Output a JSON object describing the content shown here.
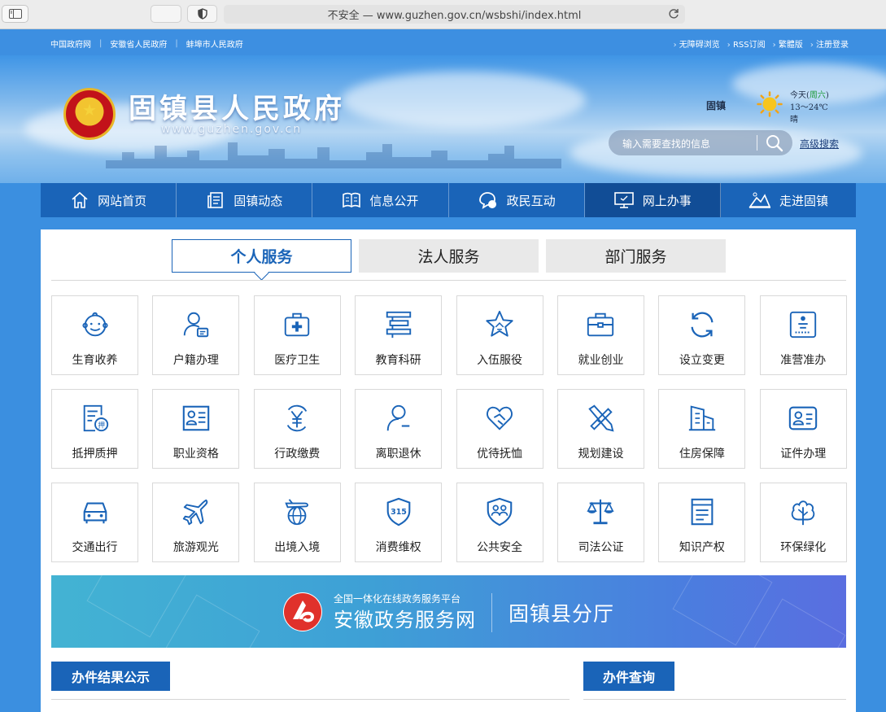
{
  "browser": {
    "url_text": "不安全 — www.guzhen.gov.cn/wsbshi/index.html"
  },
  "utilbar": {
    "left_links": [
      "中国政府网",
      "安徽省人民政府",
      "蚌埠市人民政府"
    ],
    "right_links": [
      "无障碍浏览",
      "RSS订阅",
      "繁體版",
      "注册登录"
    ]
  },
  "header": {
    "site_title": "固镇县人民政府",
    "site_url": "www.guzhen.gov.cn",
    "weather": {
      "city": "固镇",
      "day_prefix": "今天(",
      "weekday": "周六",
      "day_suffix": ")",
      "temp": "13～24℃",
      "condition": "晴"
    },
    "search_placeholder": "输入需要查找的信息",
    "advanced_search": "高级搜索"
  },
  "mainnav": [
    {
      "label": "网站首页",
      "icon": "home-icon",
      "active": false
    },
    {
      "label": "固镇动态",
      "icon": "news-icon",
      "active": false
    },
    {
      "label": "信息公开",
      "icon": "book-icon",
      "active": false
    },
    {
      "label": "政民互动",
      "icon": "chat-icon",
      "active": false
    },
    {
      "label": "网上办事",
      "icon": "monitor-icon",
      "active": true
    },
    {
      "label": "走进固镇",
      "icon": "landscape-icon",
      "active": false
    }
  ],
  "tabs": [
    {
      "label": "个人服务",
      "active": true
    },
    {
      "label": "法人服务",
      "active": false
    },
    {
      "label": "部门服务",
      "active": false
    }
  ],
  "services": [
    {
      "label": "生育收养",
      "icon": "baby-icon"
    },
    {
      "label": "户籍办理",
      "icon": "person-card-icon"
    },
    {
      "label": "医疗卫生",
      "icon": "medical-kit-icon"
    },
    {
      "label": "教育科研",
      "icon": "education-icon"
    },
    {
      "label": "入伍服役",
      "icon": "star-icon"
    },
    {
      "label": "就业创业",
      "icon": "briefcase-icon"
    },
    {
      "label": "设立变更",
      "icon": "refresh-icon"
    },
    {
      "label": "准营准办",
      "icon": "license-icon"
    },
    {
      "label": "抵押质押",
      "icon": "mortgage-icon"
    },
    {
      "label": "职业资格",
      "icon": "id-card-icon"
    },
    {
      "label": "行政缴费",
      "icon": "yen-icon"
    },
    {
      "label": "离职退休",
      "icon": "person-minus-icon"
    },
    {
      "label": "优待抚恤",
      "icon": "heart-hand-icon"
    },
    {
      "label": "规划建设",
      "icon": "ruler-pencil-icon"
    },
    {
      "label": "住房保障",
      "icon": "building-icon"
    },
    {
      "label": "证件办理",
      "icon": "id-document-icon"
    },
    {
      "label": "交通出行",
      "icon": "car-icon"
    },
    {
      "label": "旅游观光",
      "icon": "airplane-icon"
    },
    {
      "label": "出境入境",
      "icon": "plane-globe-icon"
    },
    {
      "label": "消费维权",
      "icon": "shield-315-icon"
    },
    {
      "label": "公共安全",
      "icon": "shield-people-icon"
    },
    {
      "label": "司法公证",
      "icon": "scales-icon"
    },
    {
      "label": "知识产权",
      "icon": "document-icon"
    },
    {
      "label": "环保绿化",
      "icon": "trees-icon"
    }
  ],
  "platform_banner": {
    "subtitle": "全国一体化在线政务服务平台",
    "title": "安徽政务服务网",
    "county": "固镇县分厅"
  },
  "sections": {
    "results_title": "办件结果公示",
    "query_title": "办件查询"
  },
  "colors": {
    "brand_blue": "#1a64b8",
    "nav_active": "#114d96",
    "icon_blue": "#1a64b8"
  }
}
